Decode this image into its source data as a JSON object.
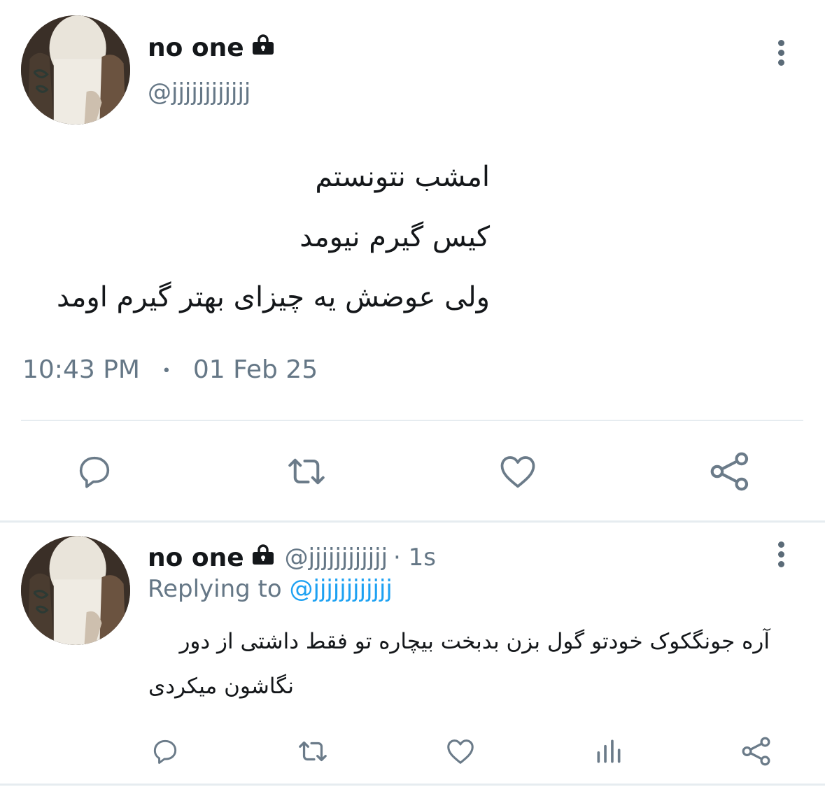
{
  "tweet": {
    "author_name": "no one",
    "author_handle": "@jjjjjjjjjjjj",
    "lines": [
      "امشب نتونستم",
      "کیس گیرم نیومد",
      "ولی عوضش یه چیزای بهتر گیرم اومد"
    ],
    "time": "10:43 PM",
    "separator": "•",
    "date": "01 Feb 25",
    "icons": [
      "lock-icon",
      "more-options-icon",
      "reply-icon",
      "retweet-icon",
      "like-icon",
      "share-icon"
    ]
  },
  "reply": {
    "author_name": "no one",
    "author_handle": "@jjjjjjjjjjjj",
    "age": "· 1s",
    "replying_to_label": "Replying to",
    "replying_to_handle": "@jjjjjjjjjjjj",
    "text_line1": "آره جونگکوک خودتو گول بزن بدبخت بیچاره تو فقط داشتی از دور",
    "text_line2": "نگاشون میکردی",
    "icons": [
      "lock-icon",
      "more-options-icon",
      "reply-icon",
      "retweet-icon",
      "like-icon",
      "analytics-icon",
      "share-icon"
    ]
  },
  "colors": {
    "text": "#14171a",
    "secondary": "#657786",
    "link": "#1da1f2",
    "divider": "#e6ecf0"
  }
}
